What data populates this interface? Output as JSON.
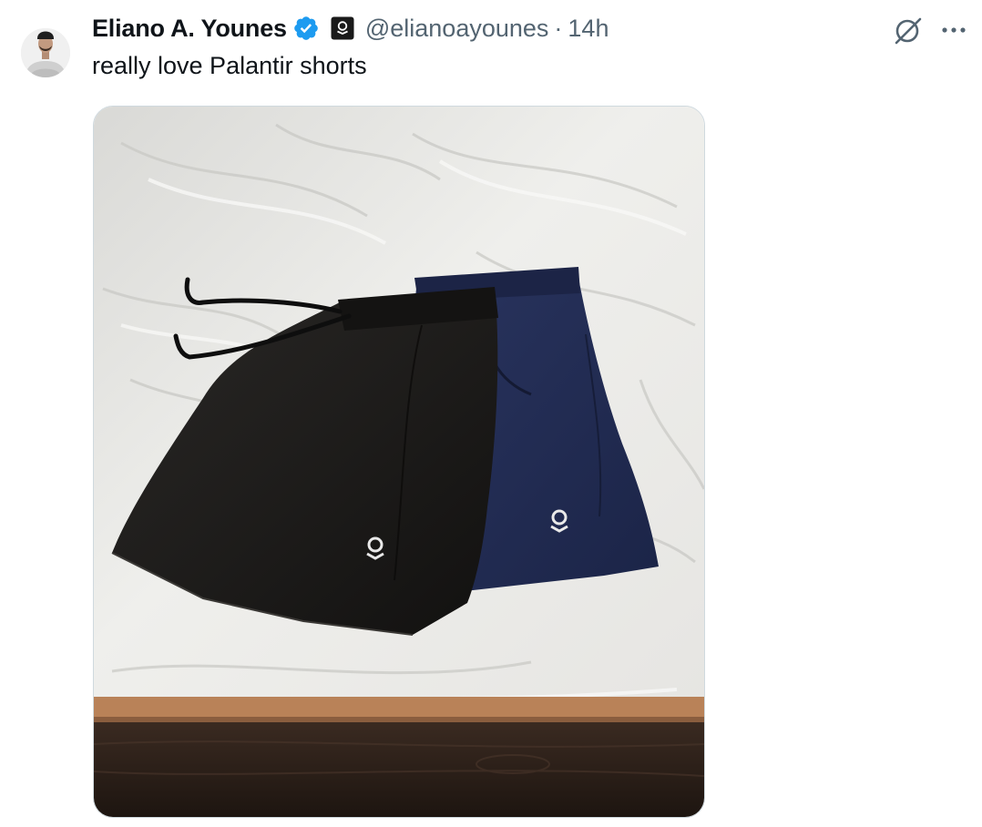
{
  "tweet": {
    "author": {
      "display_name": "Eliano A. Younes",
      "handle": "@elianoayounes",
      "verified": true,
      "avatar_icon": "person-avatar-icon",
      "affiliate_badge_icon": "palantir-logo-icon"
    },
    "separator": "·",
    "timestamp": "14h",
    "text": "really love Palantir shorts",
    "media": {
      "type": "photo",
      "logo_icon": "palantir-logo-icon"
    },
    "actions": {
      "grok_icon": "grok-slash-icon",
      "more_icon": "more-dots-icon"
    }
  },
  "colors": {
    "text_primary": "#0f1419",
    "text_secondary": "#536471",
    "verified_blue": "#1d9bf0",
    "border": "#cfd9de"
  }
}
